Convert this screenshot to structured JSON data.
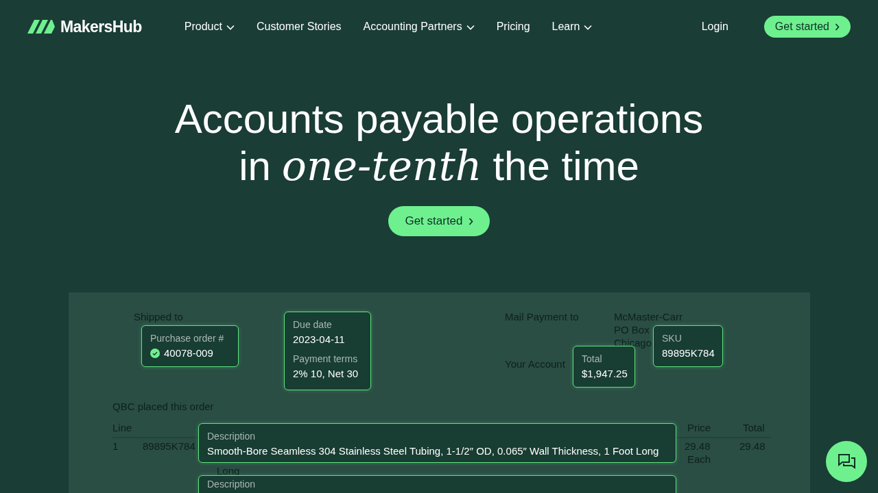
{
  "nav": {
    "logo": "MakersHub",
    "items": [
      {
        "label": "Product",
        "has_menu": true
      },
      {
        "label": "Customer Stories",
        "has_menu": false
      },
      {
        "label": "Accounting Partners",
        "has_menu": true
      },
      {
        "label": "Pricing",
        "has_menu": false
      },
      {
        "label": "Learn",
        "has_menu": true
      }
    ],
    "login": "Login",
    "cta": "Get started"
  },
  "hero": {
    "line1": "Accounts payable operations",
    "line2_start": "in",
    "line2_emphasis": "one-tenth",
    "line2_end": "the time",
    "cta": "Get started"
  },
  "invoice": {
    "shipped_to": "Shipped to",
    "mail_payment_to": "Mail Payment to",
    "vendor_lines": [
      "McMaster-Carr",
      "PO Box",
      "Chicago"
    ],
    "your_account": "Your Account",
    "placed_by": "QBC placed this order",
    "columns": {
      "line": "Line",
      "price": "Price",
      "total": "Total"
    },
    "row": {
      "line": "1",
      "sku": "89895K784",
      "price": "29.48",
      "unit": "Each",
      "total": "29.48",
      "wrap": "Long"
    }
  },
  "cards": [
    {
      "kind": "single",
      "labels": [
        "Purchase order #"
      ],
      "values": [
        "40078-009"
      ],
      "verified": true
    },
    {
      "kind": "double",
      "labels": [
        "Due date",
        "Payment terms"
      ],
      "values": [
        "2023-04-11",
        "2% 10, Net 30"
      ],
      "verified": false
    },
    {
      "kind": "single",
      "labels": [
        "Total"
      ],
      "values": [
        "$1,947.25"
      ],
      "verified": false
    },
    {
      "kind": "single",
      "labels": [
        "SKU"
      ],
      "values": [
        "89895K784"
      ],
      "verified": false
    },
    {
      "kind": "wide",
      "labels": [
        "Description"
      ],
      "values": [
        "Smooth-Bore Seamless 304 Stainless Steel Tubing, 1-1/2″ OD, 0.065″ Wall Thickness, 1 Foot Long"
      ],
      "verified": false
    },
    {
      "kind": "wide",
      "labels": [
        "Description"
      ],
      "verified": false
    }
  ]
}
